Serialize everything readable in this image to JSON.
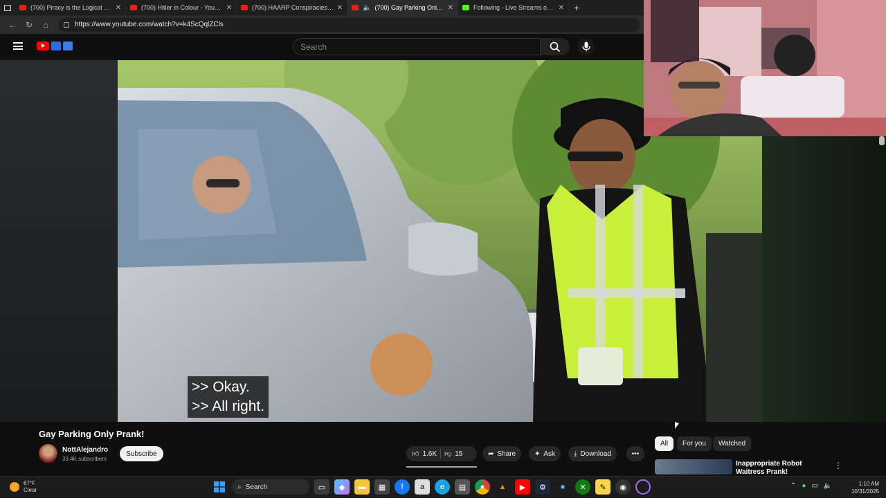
{
  "browser": {
    "tabs": [
      {
        "label": "(700) Piracy is the Logical Solutio",
        "active": false,
        "site": "youtube"
      },
      {
        "label": "(700) Hitler in Colour - YouTube",
        "active": false,
        "site": "youtube"
      },
      {
        "label": "(700) HAARP Conspiracies: Was T",
        "active": false,
        "site": "youtube"
      },
      {
        "label": "(700) Gay Parking Only Pran",
        "active": true,
        "site": "youtube"
      },
      {
        "label": "Following - Live Streams on Kick",
        "active": false,
        "site": "kick"
      }
    ],
    "url": "https://www.youtube.com/watch?v=k4ScQqlZCls"
  },
  "youtube": {
    "search_placeholder": "Search",
    "caption_lines": [
      ">> Okay.",
      ">> All right."
    ],
    "video_title": "Gay Parking Only Prank!",
    "channel_name": "NottAlejandro",
    "subscribers": "33.4K subscribers",
    "subscribe_label": "Subscribe",
    "likes": "1.6K",
    "dislikes": "15",
    "share_label": "Share",
    "ask_label": "Ask",
    "download_label": "Download",
    "chips": [
      "All",
      "For you",
      "Watched"
    ],
    "rec_title": "Inappropriate Robot Waitress Prank!"
  },
  "taskbar": {
    "temperature": "67°F",
    "condition": "Clear",
    "search_label": "Search",
    "time": "1:10 AM",
    "date": "10/31/2025"
  },
  "colors": {
    "youtube_red": "#ff0000",
    "kick_green": "#53fc18",
    "vest": "#c8f03a"
  }
}
